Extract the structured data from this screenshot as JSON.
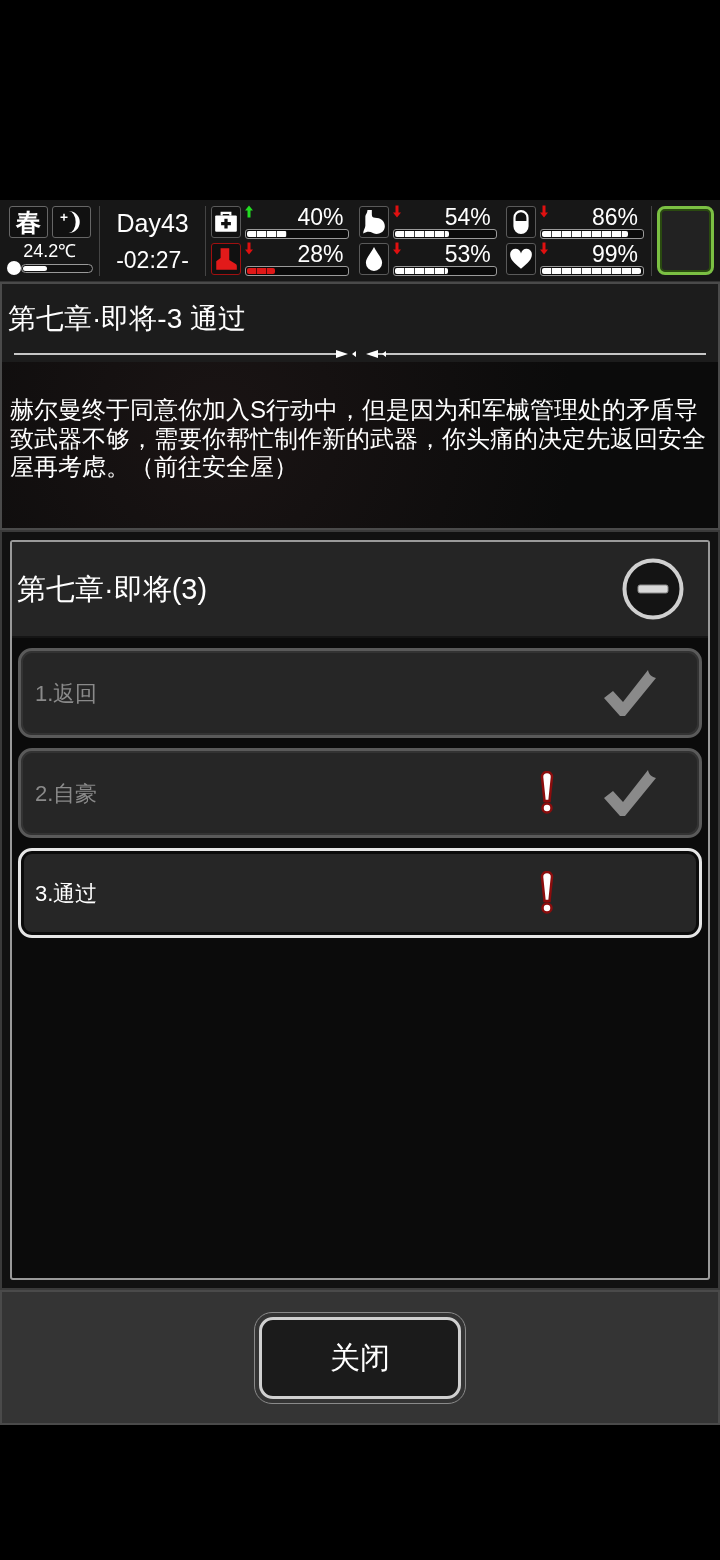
{
  "status": {
    "season": "春",
    "temperature": {
      "reading": "24.2℃",
      "level": 0.35
    },
    "day": "Day43",
    "time": "-02:27-",
    "stats": [
      {
        "kind": "health",
        "rising": true,
        "reading": "40%",
        "level": 0.4,
        "critical": false
      },
      {
        "kind": "food",
        "rising": false,
        "reading": "54%",
        "level": 0.54,
        "critical": false
      },
      {
        "kind": "energy",
        "rising": false,
        "reading": "86%",
        "level": 0.86,
        "critical": false
      },
      {
        "kind": "stamina",
        "rising": false,
        "reading": "28%",
        "level": 0.28,
        "critical": true
      },
      {
        "kind": "water",
        "rising": false,
        "reading": "53%",
        "level": 0.53,
        "critical": false
      },
      {
        "kind": "mood",
        "rising": false,
        "reading": "99%",
        "level": 0.99,
        "critical": false
      }
    ]
  },
  "chapter": {
    "title": "第七章·即将-3 通过",
    "description": "赫尔曼终于同意你加入S行动中，但是因为和军械管理处的矛盾导致武器不够，需要你帮忙制作新的武器，你头痛的决定先返回安全屋再考虑。（前往安全屋）"
  },
  "quests": {
    "title": "第七章·即将(3)",
    "expanded": true,
    "items": [
      {
        "label": "1.返回",
        "completed": true,
        "alert": false,
        "selected": false
      },
      {
        "label": "2.自豪",
        "completed": true,
        "alert": true,
        "selected": false
      },
      {
        "label": "3.通过",
        "completed": false,
        "alert": true,
        "selected": true
      }
    ]
  },
  "close_button": "关闭"
}
